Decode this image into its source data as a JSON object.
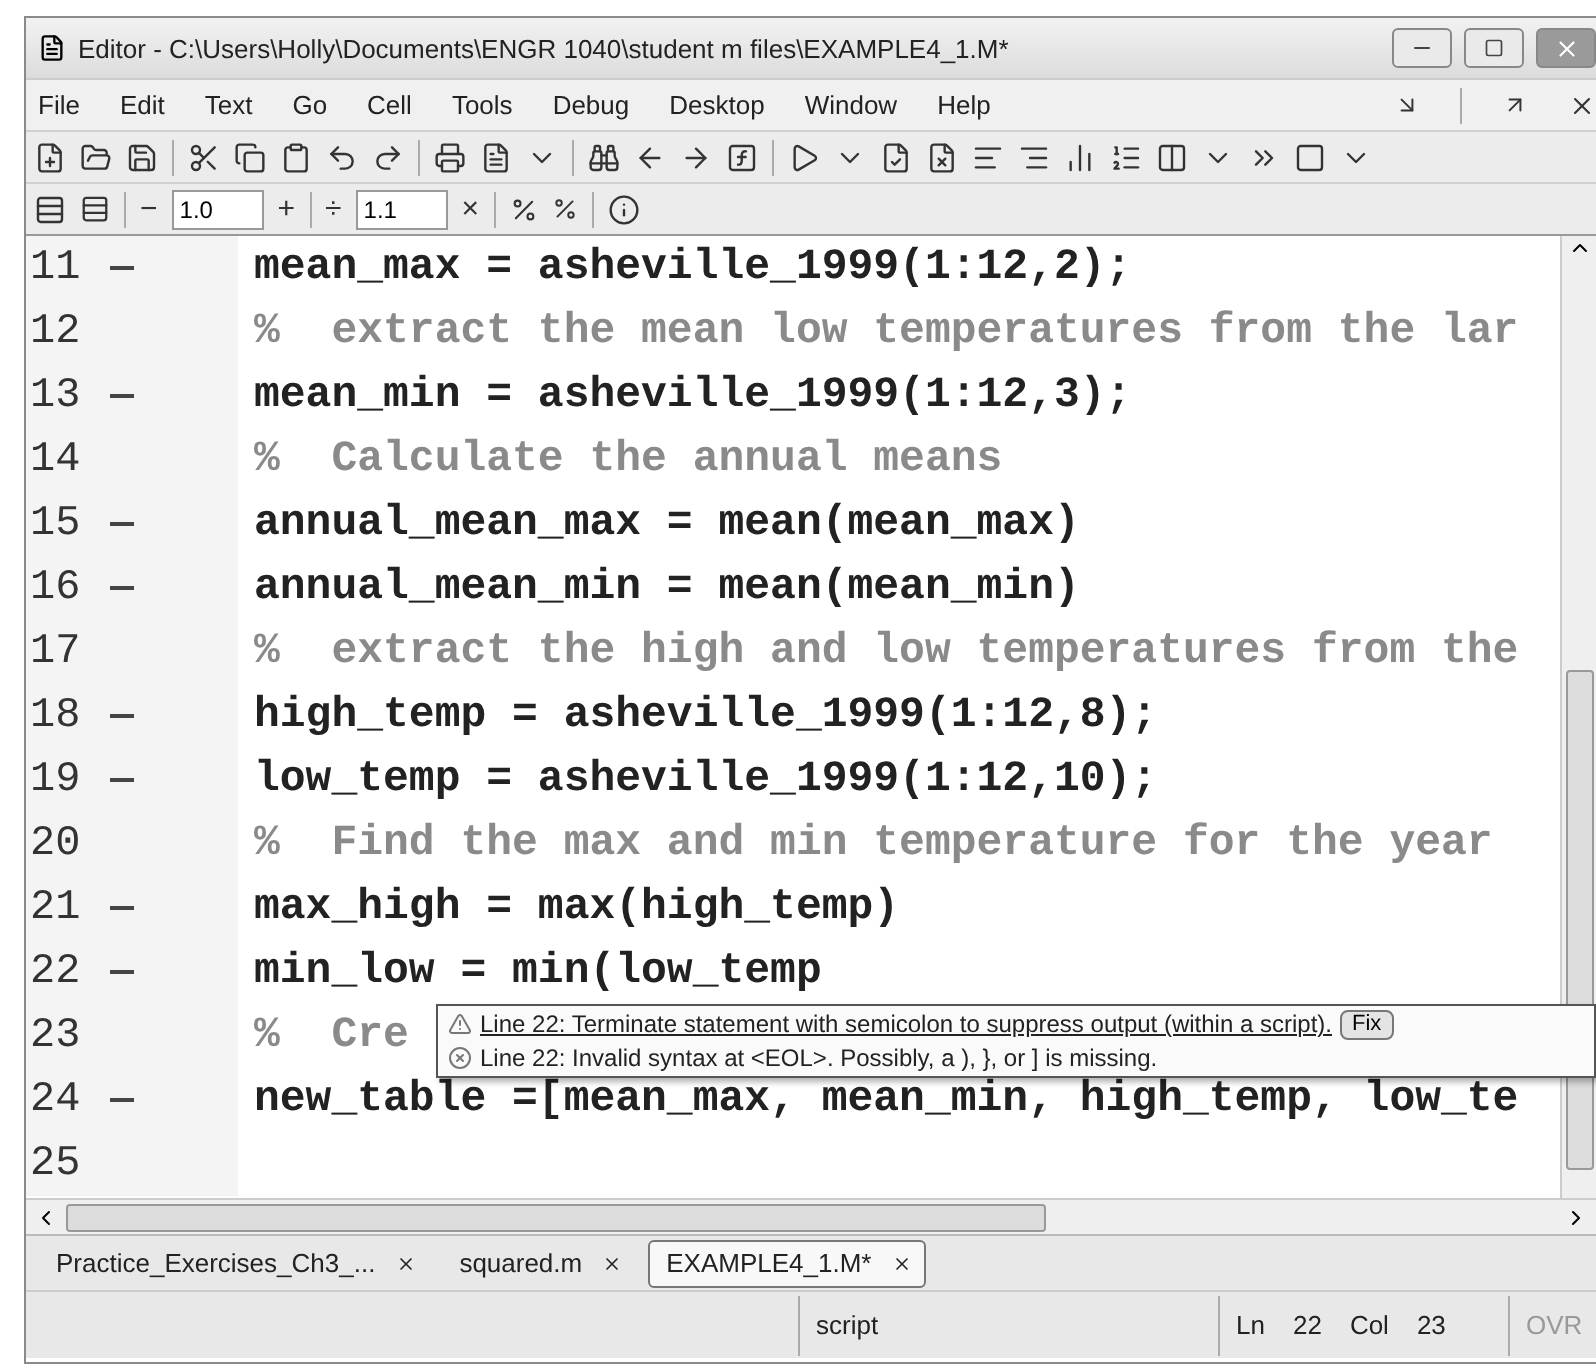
{
  "window": {
    "title": "Editor - C:\\Users\\Holly\\Documents\\ENGR 1040\\student m files\\EXAMPLE4_1.M*"
  },
  "menu": [
    "File",
    "Edit",
    "Text",
    "Go",
    "Cell",
    "Tools",
    "Debug",
    "Desktop",
    "Window",
    "Help"
  ],
  "cell_toolbar": {
    "decrement": "−",
    "step": "1.0",
    "increment": "+",
    "divide": "÷",
    "factor": "1.1",
    "multiply": "×"
  },
  "lines": [
    {
      "number": "11",
      "executable": true,
      "kind": "code",
      "text": "mean_max = asheville_1999(1:12,2);"
    },
    {
      "number": "12",
      "executable": false,
      "kind": "comment",
      "text": "%  extract the mean low temperatures from the lar"
    },
    {
      "number": "13",
      "executable": true,
      "kind": "code",
      "text": "mean_min = asheville_1999(1:12,3);"
    },
    {
      "number": "14",
      "executable": false,
      "kind": "comment",
      "text": "%  Calculate the annual means"
    },
    {
      "number": "15",
      "executable": true,
      "kind": "code",
      "text": "annual_mean_max = mean(mean_max)"
    },
    {
      "number": "16",
      "executable": true,
      "kind": "code",
      "text": "annual_mean_min = mean(mean_min)"
    },
    {
      "number": "17",
      "executable": false,
      "kind": "comment",
      "text": "%  extract the high and low temperatures from the"
    },
    {
      "number": "18",
      "executable": true,
      "kind": "code",
      "text": "high_temp = asheville_1999(1:12,8);"
    },
    {
      "number": "19",
      "executable": true,
      "kind": "code",
      "text": "low_temp = asheville_1999(1:12,10);"
    },
    {
      "number": "20",
      "executable": false,
      "kind": "comment",
      "text": "%  Find the max and min temperature for the year"
    },
    {
      "number": "21",
      "executable": true,
      "kind": "code",
      "text": "max_high = max(high_temp)"
    },
    {
      "number": "22",
      "executable": true,
      "kind": "code",
      "text": "min_low = min(low_temp"
    },
    {
      "number": "23",
      "executable": false,
      "kind": "comment",
      "text": "%  Cre"
    },
    {
      "number": "24",
      "executable": true,
      "kind": "code",
      "text": "new_table =[mean_max, mean_min, high_temp, low_te"
    },
    {
      "number": "25",
      "executable": false
    }
  ],
  "tooltip": {
    "messages": [
      {
        "kind": "warning",
        "text": "Line 22: Terminate statement with semicolon to suppress output (within a script).",
        "action": "Fix"
      },
      {
        "kind": "error",
        "text": "Line 22: Invalid syntax at <EOL>. Possibly, a ), }, or ] is missing."
      }
    ]
  },
  "tabs": [
    {
      "label": "Practice_Exercises_Ch3_...",
      "selected": false
    },
    {
      "label": "squared.m",
      "selected": false
    },
    {
      "label": "EXAMPLE4_1.M*",
      "selected": true
    }
  ],
  "status_bar": {
    "mode": "script",
    "line_label": "Ln",
    "line": "22",
    "col_label": "Col",
    "col": "23",
    "overwrite": {
      "label": "OVR",
      "disabled": true
    }
  }
}
